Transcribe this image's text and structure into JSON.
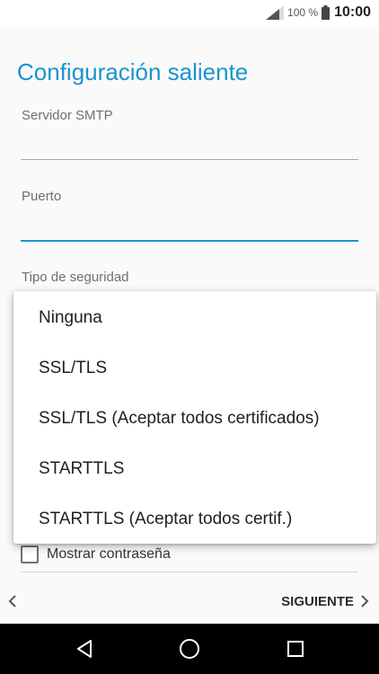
{
  "status_bar": {
    "battery_percent": "100 %",
    "time": "10:00"
  },
  "page": {
    "title": "Configuración saliente"
  },
  "form": {
    "smtp_server": {
      "label": "Servidor SMTP",
      "value": ""
    },
    "port": {
      "label": "Puerto",
      "value": ""
    },
    "security_type": {
      "label": "Tipo de seguridad"
    },
    "show_password": {
      "label": "Mostrar contraseña",
      "checked": false
    }
  },
  "dropdown": {
    "options": [
      "Ninguna",
      "SSL/TLS",
      "SSL/TLS (Aceptar todos certificados)",
      "STARTTLS",
      "STARTTLS (Aceptar todos certif.)"
    ]
  },
  "nav": {
    "next_label": "SIGUIENTE"
  },
  "icons": {
    "signal": "cell-signal-icon",
    "battery": "battery-icon",
    "back": "chevron-left-icon",
    "next": "chevron-right-icon",
    "sys_back": "triangle-back-icon",
    "sys_home": "circle-home-icon",
    "sys_recents": "square-recents-icon"
  },
  "colors": {
    "accent": "#1a93cf"
  }
}
